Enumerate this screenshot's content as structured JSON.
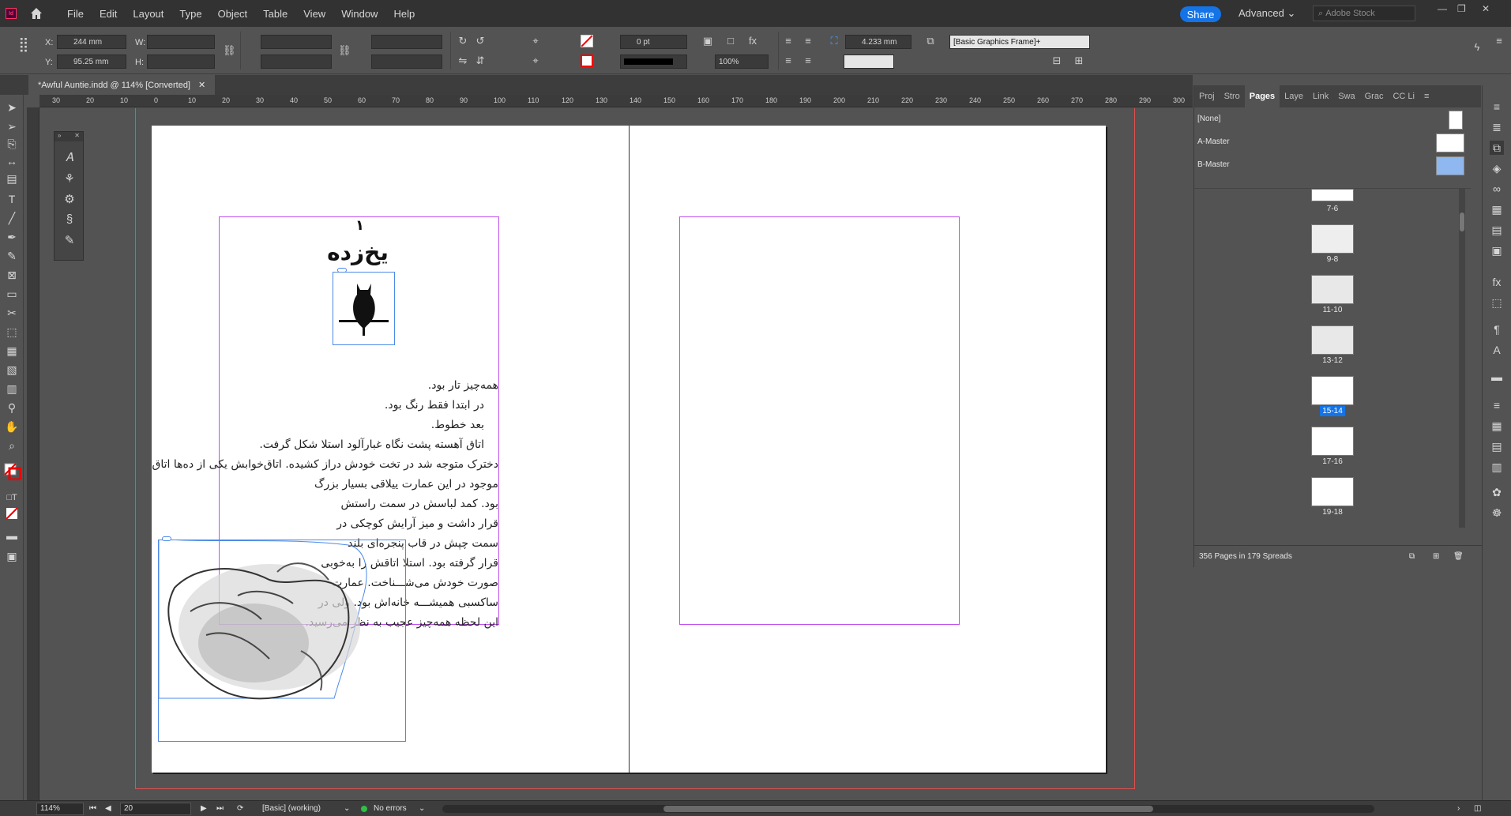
{
  "app": {
    "logo": "Id",
    "home_icon": "home-icon"
  },
  "menu": [
    "File",
    "Edit",
    "Layout",
    "Type",
    "Object",
    "Table",
    "View",
    "Window",
    "Help"
  ],
  "header": {
    "share_label": "Share",
    "workspace_label": "Advanced",
    "stock_placeholder": "Adobe Stock"
  },
  "control": {
    "x_label": "X:",
    "x_value": "244 mm",
    "y_label": "Y:",
    "y_value": "95.25 mm",
    "w_label": "W:",
    "h_label": "H:",
    "stroke_weight": "0 pt",
    "scale_value": "100%",
    "gutter_value": "4.233 mm",
    "object_style": "[Basic Graphics Frame]+"
  },
  "document": {
    "tab_title": "*Awful Auntie.indd @ 114% [Converted]"
  },
  "ruler": {
    "ticks": [
      "30",
      "20",
      "10",
      "0",
      "10",
      "20",
      "30",
      "40",
      "50",
      "60",
      "70",
      "80",
      "90",
      "100",
      "110",
      "120",
      "130",
      "140",
      "150",
      "160",
      "170",
      "180",
      "190",
      "200",
      "210",
      "220",
      "230",
      "240",
      "250",
      "260",
      "270",
      "280",
      "290",
      "300"
    ]
  },
  "page": {
    "chapter_number": "۱",
    "chapter_title": "یخ‌زده",
    "lines": [
      "همه‌چیز تار بود.",
      "در ابتدا فقط رنگ بود.",
      "بعد خطوط.",
      "اتاق آهسته پشت نگاه غبارآلود استلا شکل گرفت.",
      "دخترک متوجه شد در تخت خودش دراز کشیده. اتاق‌خوابش یکی از ده‌ها اتاق",
      "موجود در این عمارت ییلاقی بسیار بزرگ",
      "بود. کمد لباسش در سمت راستش",
      "قرار داشت و میز آرایش کوچکی در",
      "سمت چپش در قاب پنجره‌ای بلند",
      "قرار گرفته بود. استلا اتاقش را به‌خوبی",
      "صورت خودش می‌شـــناخت. عمارت",
      "ساکسبی همیشـــه خانه‌اش بود. ولی در",
      "این لحظه همه‌چیز عجیب به نظر می‌رسید."
    ]
  },
  "pages_panel": {
    "tabs": [
      "Proj",
      "Stro",
      "Pages",
      "Laye",
      "Link",
      "Swa",
      "Grac",
      "CC Li"
    ],
    "active_tab": "Pages",
    "masters": [
      "[None]",
      "A-Master",
      "B-Master"
    ],
    "spreads": [
      "7-6",
      "9-8",
      "11-10",
      "13-12",
      "15-14",
      "17-16",
      "19-18"
    ],
    "selected_spread": "15-14",
    "footer": "356 Pages in 179 Spreads"
  },
  "status": {
    "zoom": "114%",
    "page_field": "20",
    "preflight_profile": "[Basic] (working)",
    "errors": "No errors"
  }
}
